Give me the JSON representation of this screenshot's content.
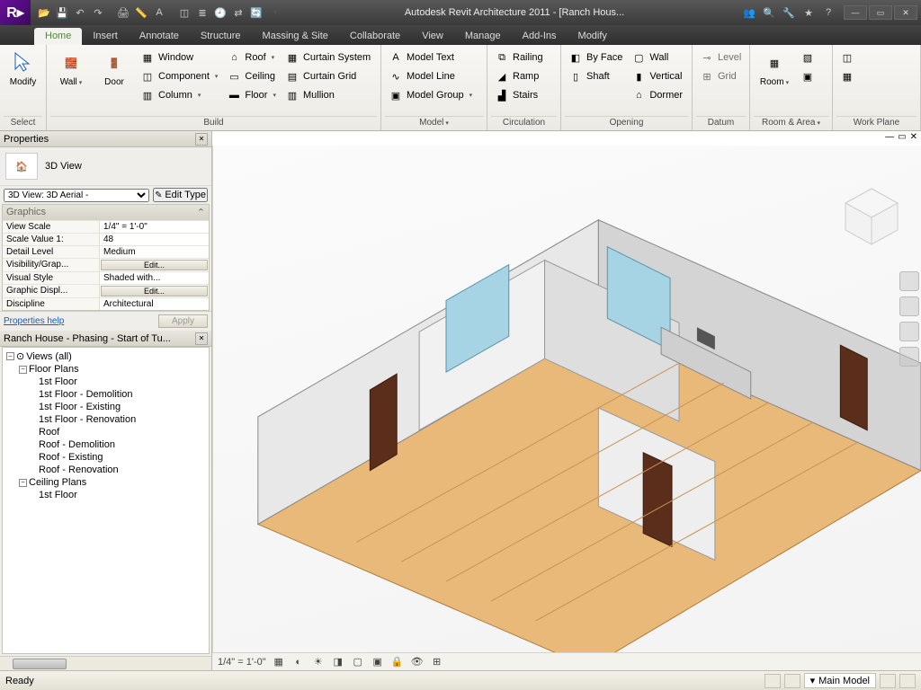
{
  "title": "Autodesk Revit Architecture 2011 - [Ranch Hous...",
  "qat_icons": [
    "open",
    "save",
    "undo",
    "redo",
    "print",
    "measure",
    "text",
    "cube",
    "checklist",
    "recent",
    "transfer",
    "sync"
  ],
  "ribbon": {
    "tabs": [
      "Home",
      "Insert",
      "Annotate",
      "Structure",
      "Massing & Site",
      "Collaborate",
      "View",
      "Manage",
      "Add-Ins",
      "Modify"
    ],
    "active": "Home",
    "panels": {
      "select": {
        "title": "Select",
        "modify": "Modify"
      },
      "build": {
        "title": "Build",
        "wall": "Wall",
        "door": "Door",
        "window": "Window",
        "component": "Component",
        "column": "Column",
        "roof": "Roof",
        "ceiling": "Ceiling",
        "floor": "Floor",
        "curtain_system": "Curtain System",
        "curtain_grid": "Curtain Grid",
        "mullion": "Mullion"
      },
      "model": {
        "title": "Model",
        "text": "Model Text",
        "line": "Model Line",
        "group": "Model Group"
      },
      "circulation": {
        "title": "Circulation",
        "railing": "Railing",
        "ramp": "Ramp",
        "stairs": "Stairs"
      },
      "opening": {
        "title": "Opening",
        "by_face": "By Face",
        "shaft": "Shaft",
        "wall": "Wall",
        "vertical": "Vertical",
        "dormer": "Dormer"
      },
      "datum": {
        "title": "Datum",
        "level": "Level",
        "grid": "Grid"
      },
      "room_area": {
        "title": "Room & Area",
        "room": "Room"
      },
      "work_plane": {
        "title": "Work Plane"
      }
    }
  },
  "properties": {
    "title": "Properties",
    "type": "3D View",
    "selector": "3D View: 3D Aerial - ",
    "edit_type": "Edit Type",
    "section": "Graphics",
    "rows": [
      {
        "label": "View Scale",
        "value": "1/4\" = 1'-0\""
      },
      {
        "label": "Scale Value    1:",
        "value": "48"
      },
      {
        "label": "Detail Level",
        "value": "Medium"
      },
      {
        "label": "Visibility/Grap...",
        "button": "Edit..."
      },
      {
        "label": "Visual Style",
        "value": "Shaded with..."
      },
      {
        "label": "Graphic Displ...",
        "button": "Edit..."
      },
      {
        "label": "Discipline",
        "value": "Architectural"
      }
    ],
    "help": "Properties help",
    "apply": "Apply"
  },
  "browser": {
    "title": "Ranch House - Phasing - Start of Tu...",
    "root": "Views (all)",
    "floor_plans": "Floor Plans",
    "fp_items": [
      "1st Floor",
      "1st Floor - Demolition",
      "1st Floor - Existing",
      "1st Floor - Renovation",
      "Roof",
      "Roof - Demolition",
      "Roof - Existing",
      "Roof - Renovation"
    ],
    "ceiling_plans": "Ceiling Plans",
    "cp_items": [
      "1st Floor"
    ]
  },
  "view_controls": {
    "scale": "1/4\" = 1'-0\""
  },
  "status": {
    "ready": "Ready",
    "main_model": "Main Model"
  }
}
